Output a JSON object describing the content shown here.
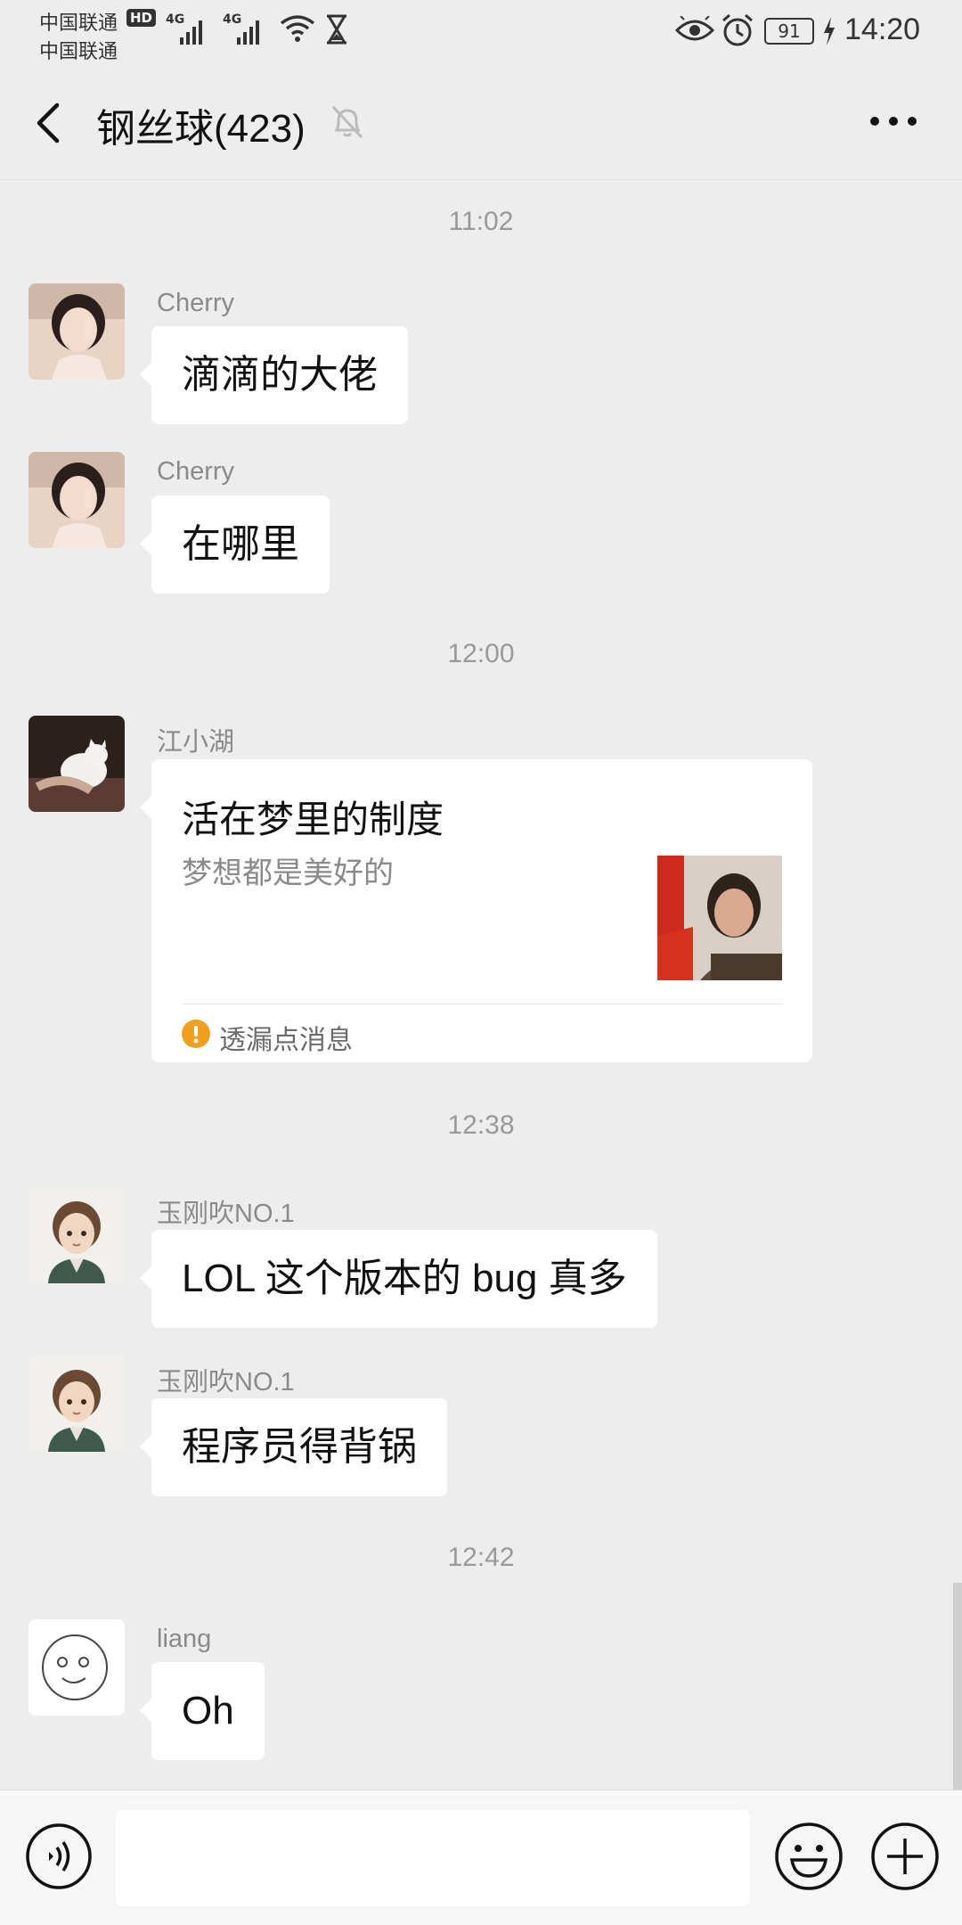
{
  "status_bar": {
    "carrier_1": "中国联通",
    "carrier_2": "中国联通",
    "hd_badge": "HD",
    "network_1": "4G",
    "network_2": "4G",
    "battery_level": "91",
    "time": "14:20"
  },
  "header": {
    "title": "钢丝球(423)",
    "icons": [
      "back-arrow-icon",
      "mute-bell-icon",
      "more-dots-icon"
    ]
  },
  "messages": [
    {
      "time": "11:02"
    },
    {
      "sender": "Cherry",
      "text": "滴滴的大佬"
    },
    {
      "sender": "Cherry",
      "text": "在哪里"
    },
    {
      "time": "12:00"
    },
    {
      "sender": "江小湖",
      "card": {
        "title": "活在梦里的制度",
        "description": "梦想都是美好的",
        "footer": "透漏点消息"
      }
    },
    {
      "time": "12:38"
    },
    {
      "sender": "玉刚吹NO.1",
      "text": "LOL 这个版本的 bug 真多"
    },
    {
      "sender": "玉刚吹NO.1",
      "text": "程序员得背锅"
    },
    {
      "time": "12:42"
    },
    {
      "sender": "liang",
      "text": "Oh"
    }
  ],
  "input_bar": {
    "placeholder": "",
    "icons": [
      "voice-icon",
      "emoji-icon",
      "plus-icon"
    ]
  },
  "colors": {
    "background": "#ededed",
    "bubble": "#ffffff",
    "warning": "#f0a020"
  }
}
